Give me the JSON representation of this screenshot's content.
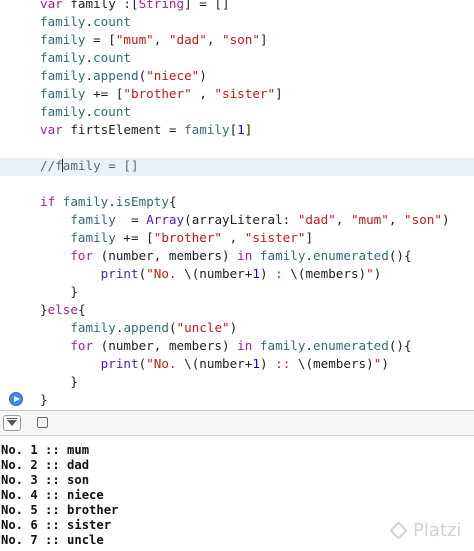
{
  "colors": {
    "keyword": "#a7228e",
    "identifier": "#326d74",
    "function": "#4b21b0",
    "string": "#c41a16",
    "number": "#1c00cf",
    "comment": "#5d6c79",
    "plain": "#1f1f1f",
    "highlight": "#e9f1fb",
    "run_button": "#3d8af7"
  },
  "editor": {
    "lines": [
      [
        [
          "k",
          "var"
        ],
        [
          "p",
          " family :["
        ],
        [
          "k",
          "String"
        ],
        [
          "p",
          "] = []"
        ]
      ],
      [
        [
          "i",
          "family"
        ],
        [
          "p",
          "."
        ],
        [
          "i",
          "count"
        ]
      ],
      [
        [
          "i",
          "family"
        ],
        [
          "p",
          " = ["
        ],
        [
          "s",
          "\"mum\""
        ],
        [
          "p",
          ", "
        ],
        [
          "s",
          "\"dad\""
        ],
        [
          "p",
          ", "
        ],
        [
          "s",
          "\"son\""
        ],
        [
          "p",
          "]"
        ]
      ],
      [
        [
          "i",
          "family"
        ],
        [
          "p",
          "."
        ],
        [
          "i",
          "count"
        ]
      ],
      [
        [
          "i",
          "family"
        ],
        [
          "p",
          "."
        ],
        [
          "i",
          "append"
        ],
        [
          "p",
          "("
        ],
        [
          "s",
          "\"niece\""
        ],
        [
          "p",
          ")"
        ]
      ],
      [
        [
          "i",
          "family"
        ],
        [
          "p",
          " += ["
        ],
        [
          "s",
          "\"brother\""
        ],
        [
          "p",
          " , "
        ],
        [
          "s",
          "\"sister\""
        ],
        [
          "p",
          "]"
        ]
      ],
      [
        [
          "i",
          "family"
        ],
        [
          "p",
          "."
        ],
        [
          "i",
          "count"
        ]
      ],
      [
        [
          "k",
          "var"
        ],
        [
          "p",
          " firtsElement = "
        ],
        [
          "i",
          "family"
        ],
        [
          "p",
          "["
        ],
        [
          "n",
          "1"
        ],
        [
          "p",
          "]"
        ]
      ],
      [],
      [
        [
          "c",
          "//f"
        ],
        [
          "caret",
          ""
        ],
        [
          "c",
          "amily = []"
        ]
      ],
      [],
      [
        [
          "k",
          "if"
        ],
        [
          "p",
          " "
        ],
        [
          "i",
          "family"
        ],
        [
          "p",
          "."
        ],
        [
          "i",
          "isEmpty"
        ],
        [
          "p",
          "{"
        ]
      ],
      [
        [
          "p",
          "    "
        ],
        [
          "i",
          "family"
        ],
        [
          "p",
          "  = "
        ],
        [
          "f",
          "Array"
        ],
        [
          "p",
          "(arrayLiteral: "
        ],
        [
          "s",
          "\"dad\""
        ],
        [
          "p",
          ", "
        ],
        [
          "s",
          "\"mum\""
        ],
        [
          "p",
          ", "
        ],
        [
          "s",
          "\"son\""
        ],
        [
          "p",
          ")"
        ]
      ],
      [
        [
          "p",
          "    "
        ],
        [
          "i",
          "family"
        ],
        [
          "p",
          " += ["
        ],
        [
          "s",
          "\"brother\""
        ],
        [
          "p",
          " , "
        ],
        [
          "s",
          "\"sister\""
        ],
        [
          "p",
          "]"
        ]
      ],
      [
        [
          "p",
          "    "
        ],
        [
          "k",
          "for"
        ],
        [
          "p",
          " (number, members) "
        ],
        [
          "k",
          "in"
        ],
        [
          "p",
          " "
        ],
        [
          "i",
          "family"
        ],
        [
          "p",
          "."
        ],
        [
          "i",
          "enumerated"
        ],
        [
          "p",
          "(){"
        ]
      ],
      [
        [
          "p",
          "        "
        ],
        [
          "f",
          "print"
        ],
        [
          "p",
          "("
        ],
        [
          "s",
          "\"No. "
        ],
        [
          "p",
          "\\(number+"
        ],
        [
          "n",
          "1"
        ],
        [
          "p",
          ")"
        ],
        [
          "s",
          " : "
        ],
        [
          "p",
          "\\(members)"
        ],
        [
          "s",
          "\""
        ],
        [
          "p",
          ")"
        ]
      ],
      [
        [
          "p",
          "    }"
        ]
      ],
      [
        [
          "p",
          "}"
        ],
        [
          "k",
          "else"
        ],
        [
          "p",
          "{"
        ]
      ],
      [
        [
          "p",
          "    "
        ],
        [
          "i",
          "family"
        ],
        [
          "p",
          "."
        ],
        [
          "i",
          "append"
        ],
        [
          "p",
          "("
        ],
        [
          "s",
          "\"uncle\""
        ],
        [
          "p",
          ")"
        ]
      ],
      [
        [
          "p",
          "    "
        ],
        [
          "k",
          "for"
        ],
        [
          "p",
          " (number, members) "
        ],
        [
          "k",
          "in"
        ],
        [
          "p",
          " "
        ],
        [
          "i",
          "family"
        ],
        [
          "p",
          "."
        ],
        [
          "i",
          "enumerated"
        ],
        [
          "p",
          "(){"
        ]
      ],
      [
        [
          "p",
          "        "
        ],
        [
          "f",
          "print"
        ],
        [
          "p",
          "("
        ],
        [
          "s",
          "\"No. "
        ],
        [
          "p",
          "\\(number+"
        ],
        [
          "n",
          "1"
        ],
        [
          "p",
          ")"
        ],
        [
          "s",
          " :: "
        ],
        [
          "p",
          "\\(members)"
        ],
        [
          "s",
          "\""
        ],
        [
          "p",
          ")"
        ]
      ],
      [
        [
          "p",
          "    }"
        ]
      ],
      [
        [
          "p",
          "}"
        ]
      ]
    ]
  },
  "toolbar": {
    "toggle_icon": "hide-debug-area-icon",
    "stop_icon": "square-icon"
  },
  "console": {
    "lines": [
      "No. 1 :: mum",
      "No. 2 :: dad",
      "No. 3 :: son",
      "No. 4 :: niece",
      "No. 5 :: brother",
      "No. 6 :: sister",
      "No. 7 :: uncle"
    ]
  },
  "watermark": {
    "text": "Platzi"
  }
}
